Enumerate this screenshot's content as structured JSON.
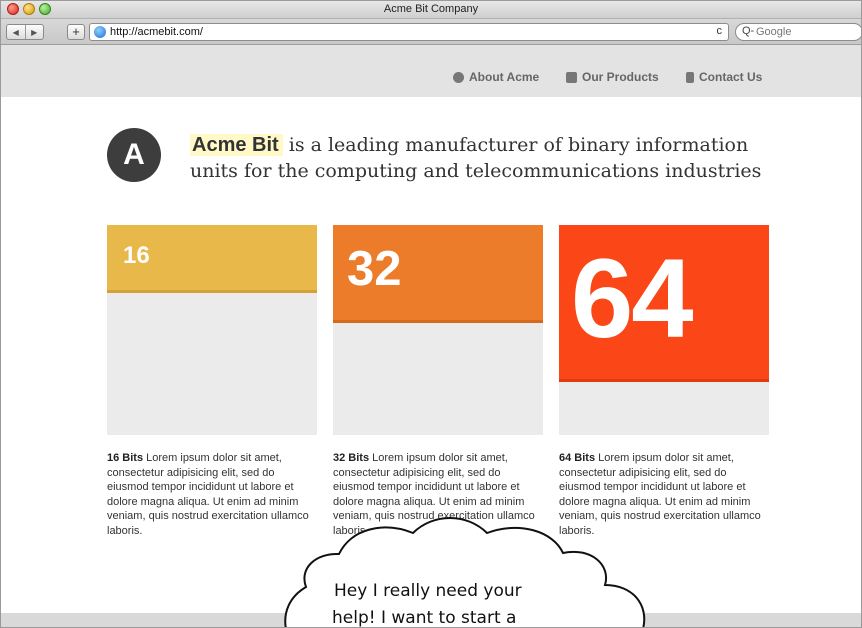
{
  "window": {
    "title": "Acme Bit Company"
  },
  "browser": {
    "url": "http://acmebit.com/",
    "back_icon": "back-arrow-icon",
    "forward_icon": "forward-arrow-icon",
    "add_label": "+",
    "reload_label": "c",
    "search_placeholder": "Google",
    "search_icon_glyph": "Q-"
  },
  "nav": {
    "items": [
      {
        "label": "About Acme",
        "icon": "circle-icon"
      },
      {
        "label": "Our Products",
        "icon": "box-icon"
      },
      {
        "label": "Contact Us",
        "icon": "phone-icon"
      }
    ]
  },
  "hero": {
    "logo_letter": "A",
    "brand": "Acme Bit",
    "tagline": " is a leading manufacturer of binary information units for the computing and telecommunications industries"
  },
  "cards": [
    {
      "number": "16",
      "title": "16 Bits",
      "fill_fraction": 0.32,
      "color": "#e9b84a",
      "text": " Lorem ipsum dolor sit amet, consectetur adipisicing elit, sed do eiusmod tempor incididunt ut labore et dolore magna aliqua. Ut enim ad minim veniam, quis nostrud exercitation ullamco laboris."
    },
    {
      "number": "32",
      "title": "32 Bits",
      "fill_fraction": 0.47,
      "color": "#ec7b2a",
      "text": " Lorem ipsum dolor sit amet, consectetur adipisicing elit, sed do eiusmod tempor incididunt ut labore et dolore magna aliqua. Ut enim ad minim veniam, quis nostrud exercitation ullamco laboris."
    },
    {
      "number": "64",
      "title": "64 Bits",
      "fill_fraction": 0.75,
      "color": "#fb4617",
      "text": " Lorem ipsum dolor sit amet, consectetur adipisicing elit, sed do eiusmod tempor incididunt ut labore et dolore magna aliqua. Ut enim ad minim veniam, quis nostrud exercitation ullamco laboris."
    }
  ],
  "bubble": {
    "line1": "Hey I really need your",
    "line2": "help! I want to start a"
  }
}
